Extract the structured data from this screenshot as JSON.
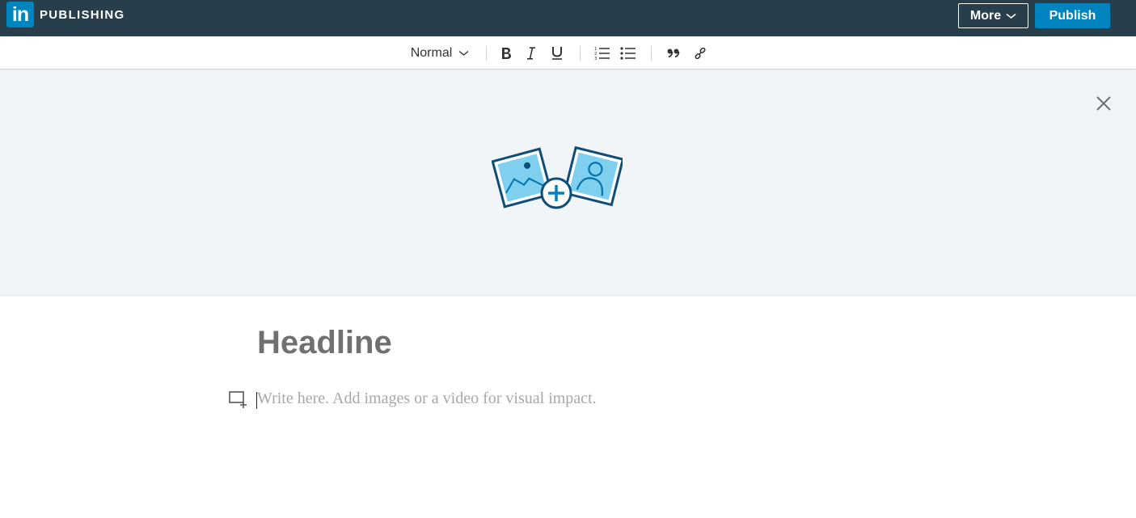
{
  "header": {
    "logo_text": "in",
    "brand_label": "PUBLISHING",
    "more_label": "More",
    "publish_label": "Publish",
    "background_color": "#283e4a",
    "accent_color": "#0084bf"
  },
  "toolbar": {
    "text_style": "Normal",
    "buttons": [
      {
        "name": "bold",
        "icon": "bold-icon"
      },
      {
        "name": "italic",
        "icon": "italic-icon"
      },
      {
        "name": "underline",
        "icon": "underline-icon"
      },
      {
        "name": "numbered-list",
        "icon": "numbered-list-icon"
      },
      {
        "name": "bulleted-list",
        "icon": "bulleted-list-icon"
      },
      {
        "name": "quote",
        "icon": "quote-icon"
      },
      {
        "name": "link",
        "icon": "link-icon"
      }
    ]
  },
  "cover": {
    "background_color": "#f2f5f7",
    "icon": "add-cover-image-icon",
    "close_icon": "close-icon"
  },
  "editor": {
    "headline_placeholder": "Headline",
    "body_placeholder": "Write here. Add images or a video for visual impact.",
    "add_media_icon": "add-media-icon"
  }
}
